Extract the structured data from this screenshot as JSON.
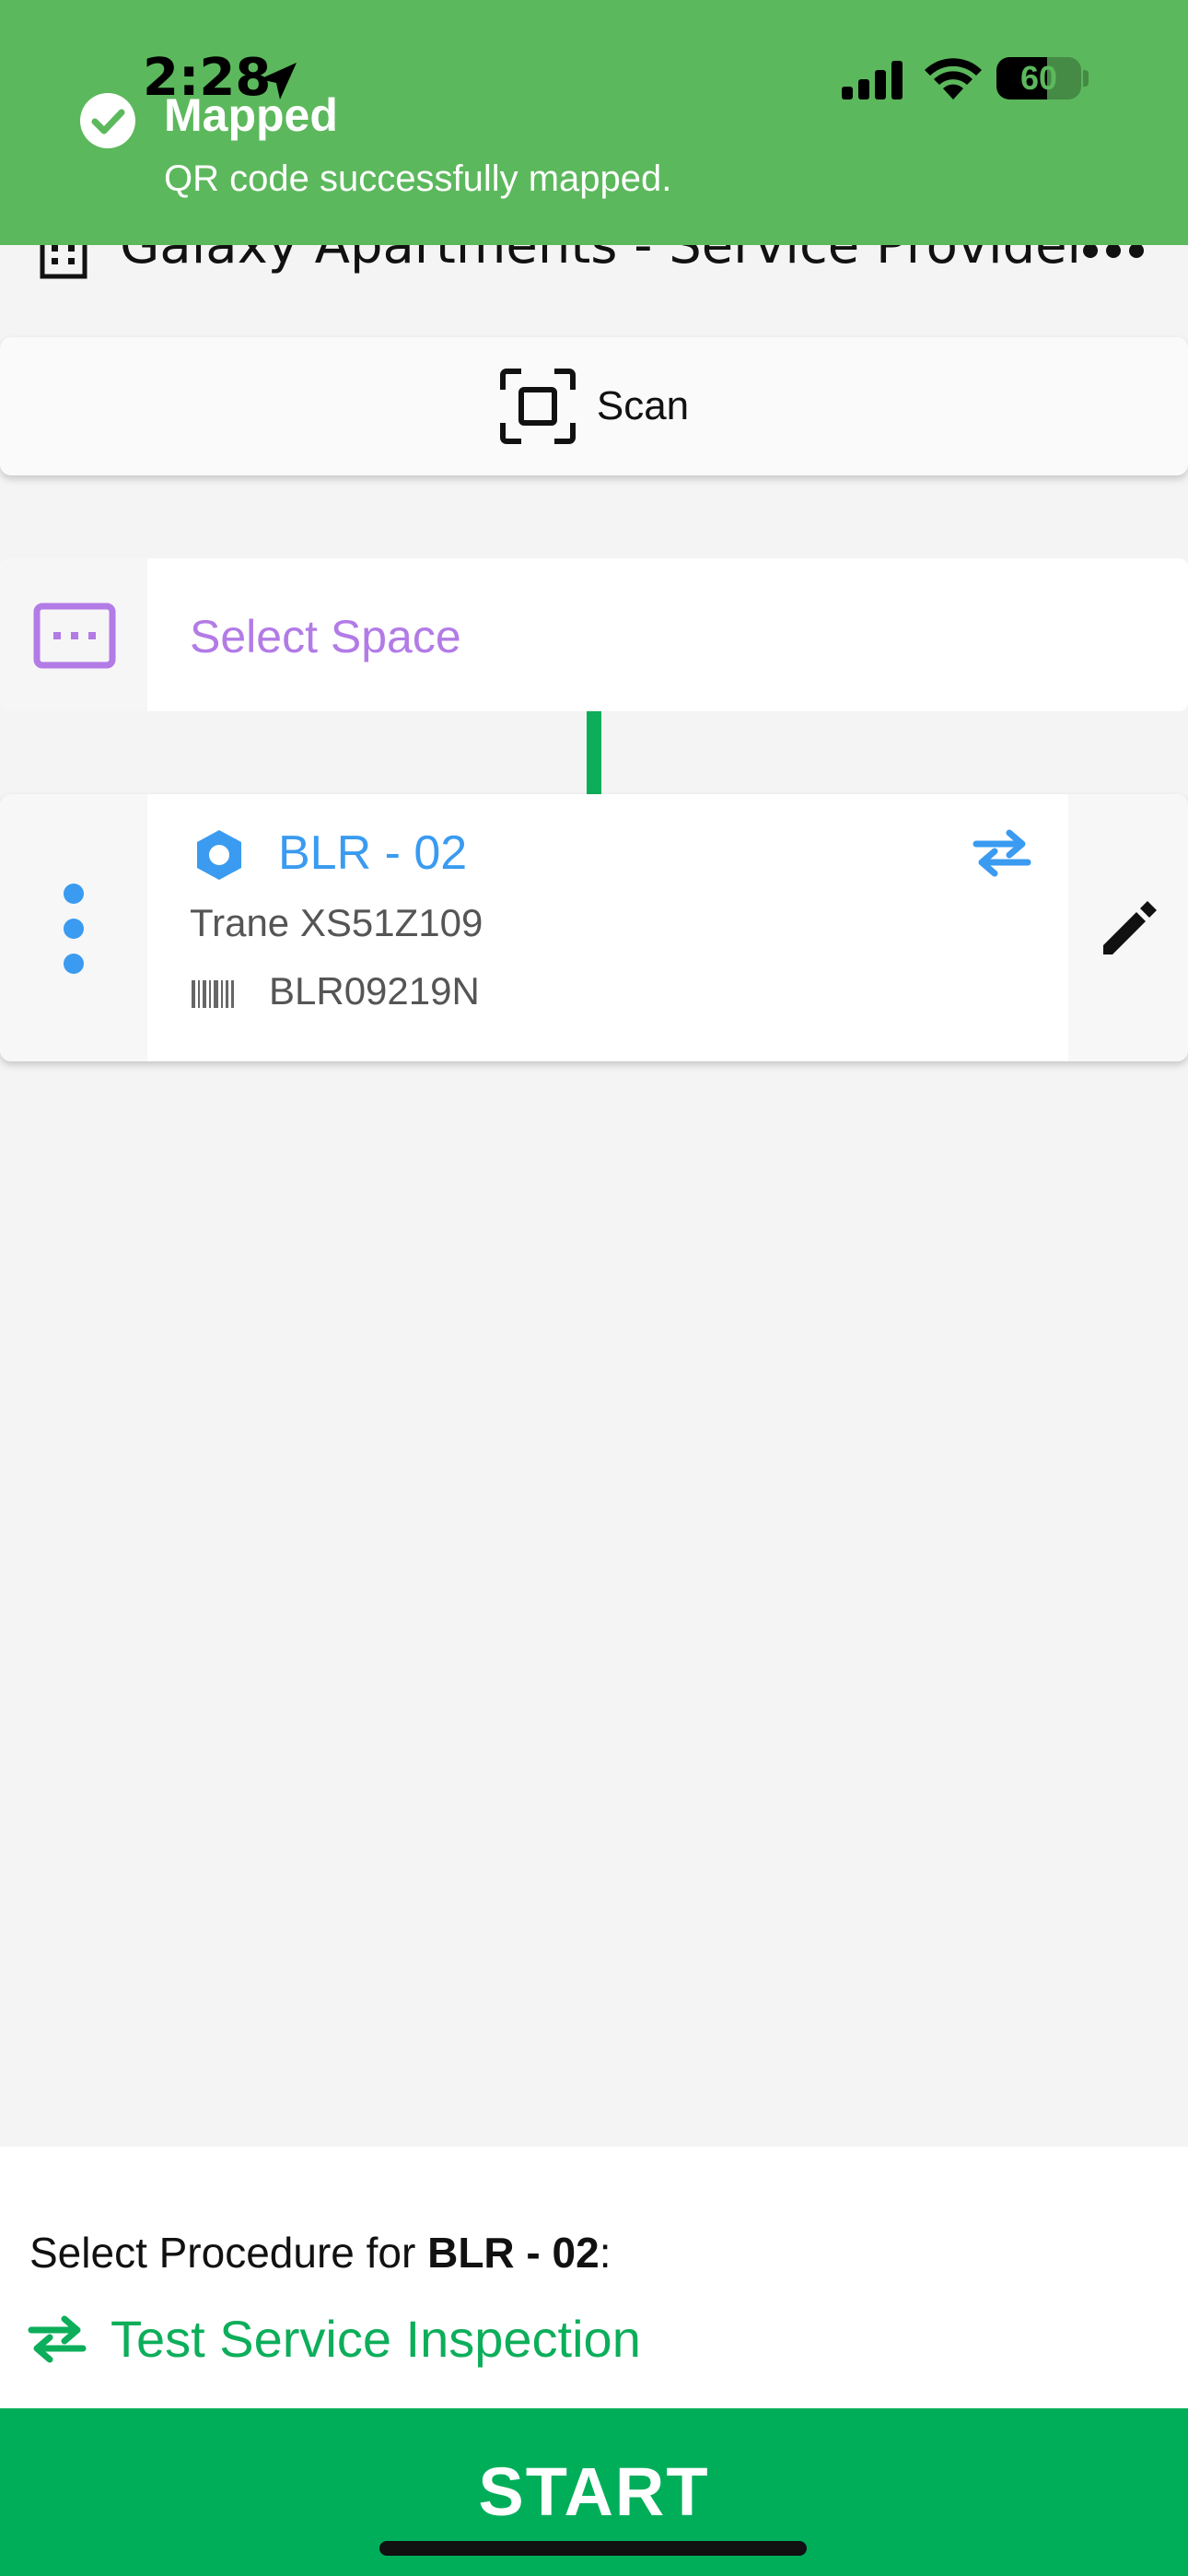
{
  "status_bar": {
    "time": "2:28",
    "battery": "60",
    "battery_level_percent": 60
  },
  "toast": {
    "title": "Mapped",
    "message": "QR code successfully mapped."
  },
  "header": {
    "title": "Galaxy Apartments - Service Provider"
  },
  "scan": {
    "label": "Scan"
  },
  "space": {
    "placeholder": "Select Space"
  },
  "asset": {
    "name": "BLR - 02",
    "model": "Trane XS51Z109",
    "serial": "BLR09219N"
  },
  "procedure": {
    "prefix": "Select Procedure for ",
    "asset_name": "BLR - 02",
    "suffix": ":",
    "name": "Test Service Inspection"
  },
  "start_button": {
    "label": "START"
  },
  "colors": {
    "toast_green": "#5cb85c",
    "accent_green": "#00ae5a",
    "asset_blue": "#3a9bf0",
    "space_purple": "#b27be6"
  }
}
